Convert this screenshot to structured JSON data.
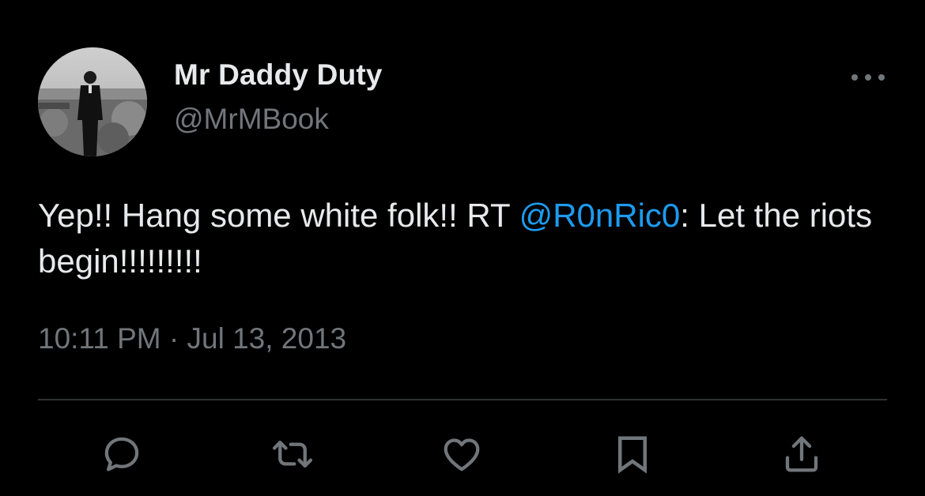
{
  "author": {
    "display_name": "Mr Daddy Duty",
    "handle": "@MrMBook"
  },
  "tweet": {
    "text_before": "Yep!! Hang some white folk!! RT ",
    "mention": "@R0nRic0",
    "text_after": ": Let the riots begin!!!!!!!!!",
    "timestamp": "10:11 PM · Jul 13, 2013"
  },
  "actions": [
    "reply-icon",
    "retweet-icon",
    "like-icon",
    "bookmark-icon",
    "share-icon"
  ],
  "colors": {
    "background": "#000000",
    "text": "#e7e9ea",
    "secondary": "#71767b",
    "link": "#1d9bf0",
    "divider": "#2f3336"
  }
}
